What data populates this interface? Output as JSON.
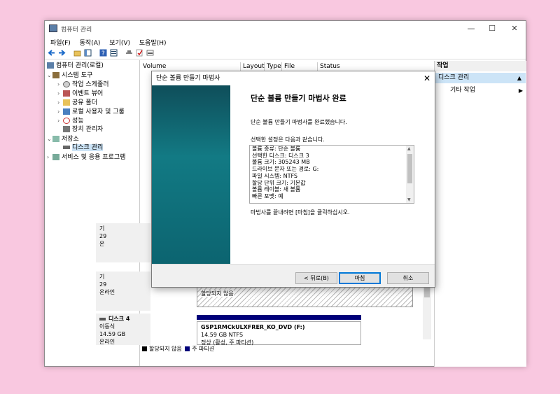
{
  "window": {
    "title": "컴퓨터 관리",
    "controls": {
      "minimize": "—",
      "maximize": "☐",
      "close": "✕"
    }
  },
  "menu": [
    "파일(F)",
    "동작(A)",
    "보기(V)",
    "도움말(H)"
  ],
  "tree": {
    "root": "컴퓨터 관리(로컬)",
    "system_tools": "시스템 도구",
    "task_scheduler": "작업 스케줄러",
    "event_viewer": "이벤트 뷰어",
    "shared_folders": "공유 폴더",
    "local_users": "로컬 사용자 및 그룹",
    "performance": "성능",
    "device_manager": "장치 관리자",
    "storage": "저장소",
    "disk_management": "디스크 관리",
    "services": "서비스 및 응용 프로그램"
  },
  "columns": [
    "Volume",
    "Layout",
    "Type",
    "File System",
    "Status"
  ],
  "disks": {
    "disk_a": {
      "lines": [
        "기",
        "29",
        "온"
      ]
    },
    "disk_b": {
      "lines": [
        "기",
        "29",
        "온라인"
      ],
      "partition": "할당되지 않음"
    },
    "disk4": {
      "name": "디스크 4",
      "type": "이동식",
      "size": "14.59 GB",
      "status": "온라인",
      "partition_name": "GSP1RMCkULXFRER_KO_DVD  (F:)",
      "partition_size": "14.59 GB NTFS",
      "partition_status": "정상 (활성, 주 파티션)"
    }
  },
  "legend": {
    "unallocated": "할당되지 않음",
    "primary": "주 파티션"
  },
  "actions": {
    "header": "작업",
    "selected": "디스크 관리",
    "more": "기타 작업"
  },
  "dialog": {
    "title": "단순 볼륨 만들기 마법사",
    "heading": "단순 볼륨 만들기 마법사 완료",
    "intro": "단순 볼륨 만들기 마법사를 완료했습니다.",
    "settings_label": "선택한 설정은 다음과 같습니다.",
    "settings": [
      "볼륨 종류: 단순 볼륨",
      "선택한 디스크: 디스크 3",
      "볼륨 크기: 305243 MB",
      "드라이브 문자 또는 경로: G:",
      "파일 시스템: NTFS",
      "할당 단위 크기: 기본값",
      "볼륨 레이블: 새 볼륨",
      "빠른 포맷: 예"
    ],
    "closing": "마법사를 끝내려면 [마침]을 클릭하십시오.",
    "back_button": "< 뒤로(B)",
    "finish_button": "마침",
    "cancel_button": "취소"
  },
  "colors": {
    "primary_partition": "#00007a",
    "selection": "#cce4f7",
    "wizard_banner": "#127a84",
    "background": "#f9c8e0"
  }
}
